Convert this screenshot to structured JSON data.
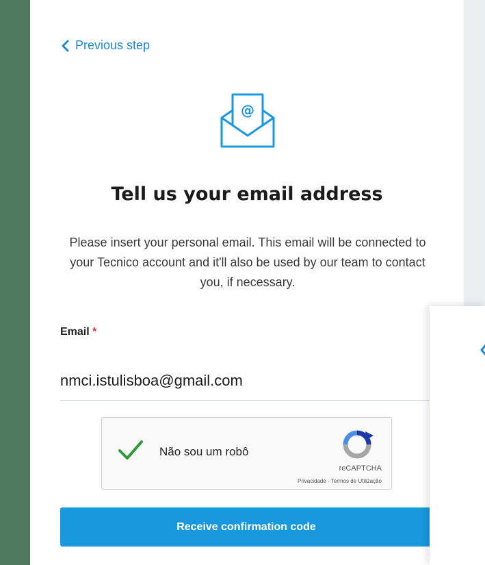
{
  "nav": {
    "back_label": "Previous step"
  },
  "header": {
    "title": "Tell us your email address"
  },
  "intro": {
    "text": "Please insert your personal email. This email will be connected to your Tecnico account and it'll also be used by our team to contact you, if necessary."
  },
  "form": {
    "email_label": "Email",
    "required_mark": "*",
    "email_value": "nmci.istulisboa@gmail.com"
  },
  "captcha": {
    "checked": true,
    "label": "Não sou um robô",
    "brand": "reCAPTCHA",
    "terms": "Privacidade - Termos de Utilização"
  },
  "action": {
    "submit_label": "Receive confirmation code"
  },
  "colors": {
    "page_bg": "#4f7a5f",
    "accent": "#1a98dd",
    "link": "#1a8ad4",
    "check": "#2e9a3a",
    "required": "#e0322f"
  },
  "icons": {
    "back": "chevron-left-icon",
    "envelope": "email-envelope-icon",
    "checkmark": "checkmark-icon",
    "recaptcha": "recaptcha-logo-icon"
  }
}
